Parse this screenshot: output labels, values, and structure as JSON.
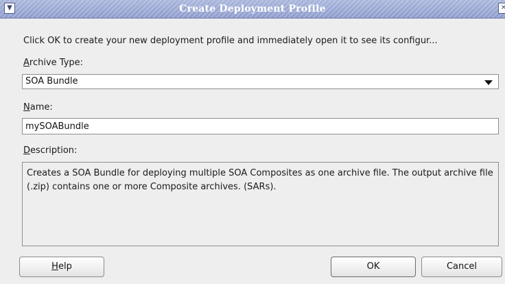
{
  "window": {
    "title": "Create Deployment Profile",
    "menu_icon": "chevron-down-icon",
    "close_icon": "close-icon"
  },
  "instructions": "Click OK to create your new deployment profile and immediately open it to see its configur...",
  "archive_type": {
    "label_mnemonic": "A",
    "label_rest": "rchive Type:",
    "value": "SOA Bundle",
    "icon": "dropdown-arrow-icon"
  },
  "name": {
    "label_mnemonic": "N",
    "label_rest": "ame:",
    "value": "mySOABundle"
  },
  "description": {
    "label_mnemonic": "D",
    "label_rest": "escription:",
    "text": "Creates a SOA Bundle for deploying multiple SOA Composites as one archive file. The output archive file (.zip) contains one or more Composite archives. (SARs)."
  },
  "buttons": {
    "help_mnemonic": "H",
    "help_rest": "elp",
    "ok": "OK",
    "cancel": "Cancel"
  },
  "colors": {
    "titlebar": "#8d9bcc",
    "dialog_bg": "#eeeeee"
  }
}
